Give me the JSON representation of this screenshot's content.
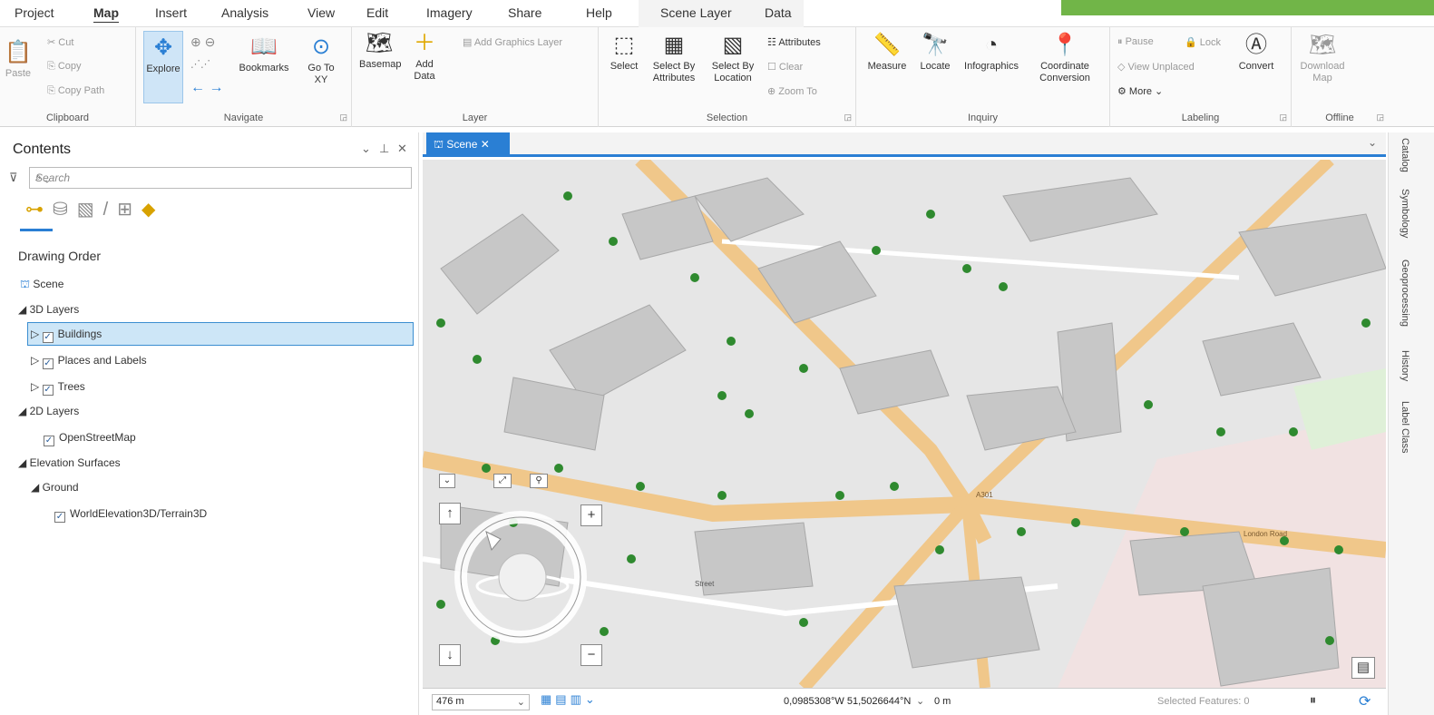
{
  "ribbon_tabs": [
    "Project",
    "Map",
    "Insert",
    "Analysis",
    "View",
    "Edit",
    "Imagery",
    "Share",
    "Help",
    "Scene Layer",
    "Data"
  ],
  "clipboard": {
    "paste": "Paste",
    "cut": "Cut",
    "copy": "Copy",
    "copy_path": "Copy Path",
    "group": "Clipboard"
  },
  "navigate": {
    "explore": "Explore",
    "bookmarks": "Bookmarks",
    "goto": "Go To XY",
    "group": "Navigate"
  },
  "layer": {
    "basemap": "Basemap",
    "add_data": "Add Data",
    "add_graphics": "Add Graphics Layer",
    "group": "Layer"
  },
  "selection": {
    "select": "Select",
    "by_attributes": "Select By Attributes",
    "by_location": "Select By Location",
    "attributes": "Attributes",
    "clear": "Clear",
    "zoom_to": "Zoom To",
    "group": "Selection"
  },
  "inquiry": {
    "measure": "Measure",
    "locate": "Locate",
    "infographics": "Infographics",
    "coord": "Coordinate Conversion",
    "group": "Inquiry"
  },
  "labeling": {
    "pause": "Pause",
    "lock": "Lock",
    "view_unplaced": "View Unplaced",
    "more": "More",
    "convert": "Convert",
    "group": "Labeling"
  },
  "offline": {
    "download": "Download Map",
    "group": "Offline"
  },
  "contents": {
    "title": "Contents",
    "search_placeholder": "Search",
    "drawing_order": "Drawing Order",
    "scene": "Scene",
    "layers_3d": "3D Layers",
    "buildings": "Buildings",
    "places": "Places and Labels",
    "trees": "Trees",
    "layers_2d": "2D Layers",
    "osm": "OpenStreetMap",
    "elevation": "Elevation Surfaces",
    "ground": "Ground",
    "terrain": "WorldElevation3D/Terrain3D"
  },
  "view": {
    "tab": "Scene"
  },
  "status": {
    "scale": "476 m",
    "coords": "0,0985308°W 51,5026644°N",
    "elev": "0 m",
    "selected": "Selected Features: 0"
  },
  "side_tabs": [
    "Catalog",
    "Symbology",
    "Geoprocessing",
    "History",
    "Label Class"
  ],
  "map_labels": {
    "london_road": "London Road",
    "street": "Street",
    "a301": "A301"
  },
  "colors": {
    "accent": "#2a7fd4",
    "road": "#f0c78a",
    "building": "#c8c8c8",
    "tree": "#2f8a2f",
    "green": "#71b548"
  }
}
